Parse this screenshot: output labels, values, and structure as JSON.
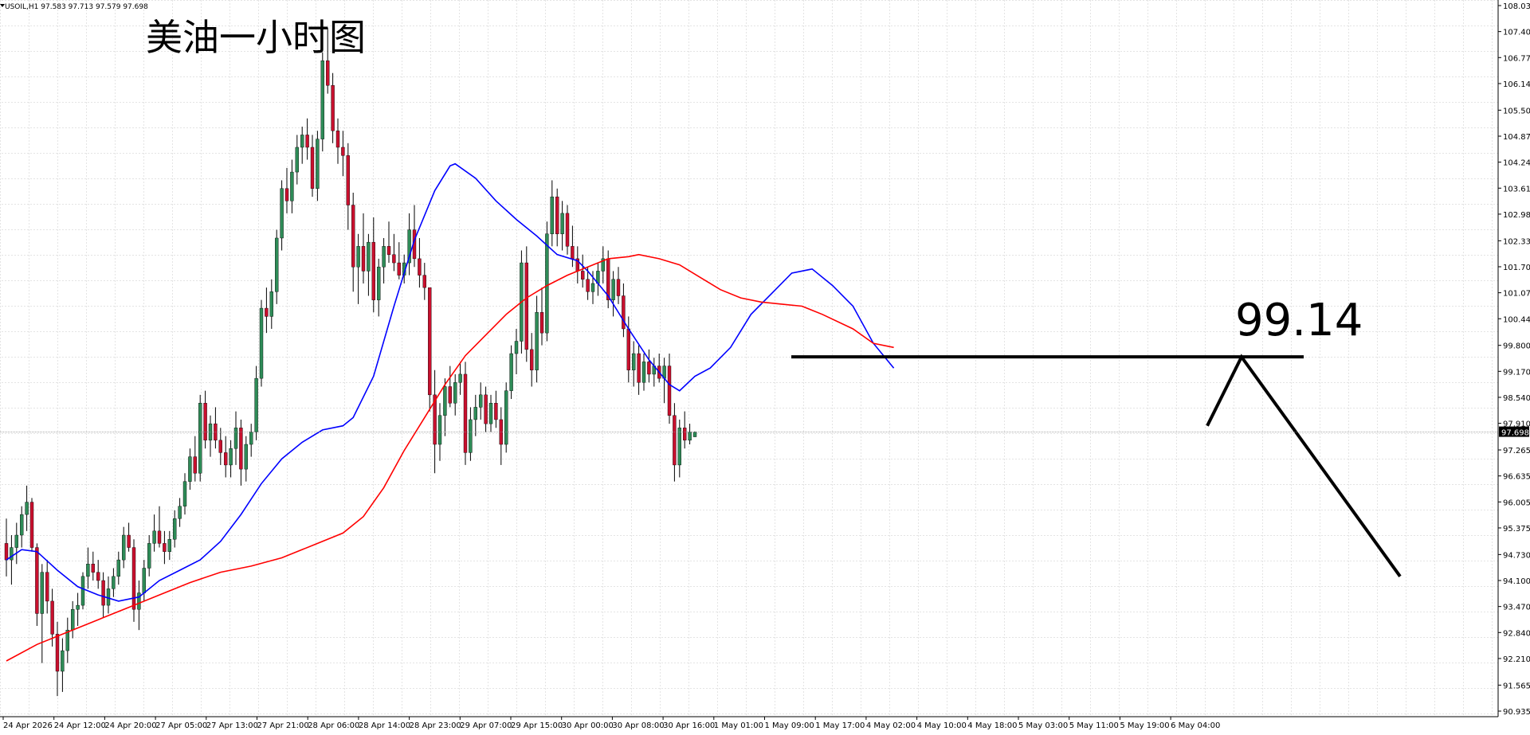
{
  "header": {
    "symbol_line": "USOIL,H1  97.583 97.713 97.579 97.698"
  },
  "annotations": {
    "title": "美油一小时图",
    "level_value": "99.14"
  },
  "colors": {
    "background": "#ffffff",
    "grid": "#c8c8c8",
    "bull_candle": "#2e8b57",
    "bear_candle": "#c8102e",
    "wick": "#000000",
    "ma_fast": "#0000ff",
    "ma_slow": "#ff0000",
    "drawing": "#000000",
    "price_tag": "#000000"
  },
  "chart_data": {
    "type": "candlestick",
    "title": "美油一小时图",
    "symbol": "USOIL",
    "timeframe": "H1",
    "last_bar": {
      "open": 97.583,
      "high": 97.713,
      "low": 97.579,
      "close": 97.698
    },
    "current_price": "97.698",
    "ylim": [
      90.935,
      108.035
    ],
    "y_ticks": [
      "108.035",
      "107.405",
      "106.775",
      "106.145",
      "105.500",
      "104.870",
      "104.240",
      "103.610",
      "102.980",
      "102.335",
      "101.705",
      "101.075",
      "100.445",
      "99.800",
      "99.170",
      "98.540",
      "97.910",
      "97.265",
      "96.635",
      "96.005",
      "95.375",
      "94.730",
      "94.100",
      "93.470",
      "92.840",
      "92.210",
      "91.565",
      "90.935"
    ],
    "x_ticks": [
      "24 Apr 2026",
      "24 Apr 12:00",
      "24 Apr 20:00",
      "27 Apr 05:00",
      "27 Apr 13:00",
      "27 Apr 21:00",
      "28 Apr 06:00",
      "28 Apr 14:00",
      "28 Apr 23:00",
      "29 Apr 07:00",
      "29 Apr 15:00",
      "30 Apr 00:00",
      "30 Apr 08:00",
      "30 Apr 16:00",
      "1 May 01:00",
      "1 May 09:00",
      "1 May 17:00",
      "4 May 02:00",
      "4 May 10:00",
      "4 May 18:00",
      "5 May 03:00",
      "5 May 11:00",
      "5 May 19:00",
      "6 May 04:00"
    ],
    "bars": [
      [
        95.0,
        95.6,
        94.2,
        94.6
      ],
      [
        94.6,
        95.2,
        94.0,
        94.9
      ],
      [
        94.9,
        95.5,
        94.5,
        95.2
      ],
      [
        95.2,
        95.9,
        94.9,
        95.7
      ],
      [
        95.7,
        96.4,
        95.3,
        96.0
      ],
      [
        96.0,
        96.1,
        94.8,
        94.9
      ],
      [
        94.9,
        95.0,
        93.0,
        93.3
      ],
      [
        93.3,
        94.5,
        92.1,
        94.3
      ],
      [
        94.3,
        94.6,
        93.3,
        93.6
      ],
      [
        93.6,
        93.9,
        92.5,
        92.8
      ],
      [
        92.8,
        93.1,
        91.3,
        91.9
      ],
      [
        91.9,
        92.7,
        91.4,
        92.4
      ],
      [
        92.4,
        93.2,
        92.1,
        92.9
      ],
      [
        92.9,
        93.6,
        92.7,
        93.4
      ],
      [
        93.4,
        93.8,
        93.0,
        93.5
      ],
      [
        93.5,
        94.3,
        93.4,
        94.2
      ],
      [
        94.2,
        94.9,
        93.9,
        94.5
      ],
      [
        94.5,
        94.8,
        94.1,
        94.3
      ],
      [
        94.3,
        94.6,
        93.9,
        94.1
      ],
      [
        94.1,
        94.3,
        93.2,
        93.5
      ],
      [
        93.5,
        94.2,
        93.3,
        93.9
      ],
      [
        93.9,
        94.4,
        93.7,
        94.2
      ],
      [
        94.2,
        94.8,
        94.0,
        94.6
      ],
      [
        94.6,
        95.4,
        94.4,
        95.2
      ],
      [
        95.2,
        95.5,
        94.8,
        94.9
      ],
      [
        94.9,
        95.1,
        93.1,
        93.4
      ],
      [
        93.4,
        94.1,
        92.9,
        93.8
      ],
      [
        93.8,
        94.6,
        93.6,
        94.4
      ],
      [
        94.4,
        95.2,
        94.2,
        95.0
      ],
      [
        95.0,
        95.7,
        94.8,
        95.3
      ],
      [
        95.3,
        95.9,
        94.9,
        95.0
      ],
      [
        95.0,
        95.3,
        94.5,
        94.8
      ],
      [
        94.8,
        95.3,
        94.6,
        95.1
      ],
      [
        95.1,
        95.8,
        94.9,
        95.6
      ],
      [
        95.6,
        96.1,
        95.4,
        95.9
      ],
      [
        95.9,
        96.7,
        95.7,
        96.5
      ],
      [
        96.5,
        97.3,
        96.3,
        97.1
      ],
      [
        97.1,
        97.6,
        96.5,
        96.7
      ],
      [
        96.7,
        98.6,
        96.5,
        98.4
      ],
      [
        98.4,
        98.7,
        97.3,
        97.5
      ],
      [
        97.5,
        98.1,
        97.1,
        97.9
      ],
      [
        97.9,
        98.3,
        97.3,
        97.5
      ],
      [
        97.5,
        97.8,
        96.9,
        97.2
      ],
      [
        97.2,
        97.6,
        96.6,
        96.9
      ],
      [
        96.9,
        97.5,
        96.6,
        97.3
      ],
      [
        97.3,
        98.2,
        96.9,
        97.8
      ],
      [
        97.8,
        98.0,
        96.4,
        96.8
      ],
      [
        96.8,
        97.6,
        96.5,
        97.4
      ],
      [
        97.4,
        97.9,
        97.1,
        97.7
      ],
      [
        97.7,
        99.3,
        97.5,
        99.0
      ],
      [
        99.0,
        100.9,
        98.8,
        100.7
      ],
      [
        100.7,
        101.2,
        100.1,
        100.5
      ],
      [
        100.5,
        101.4,
        100.2,
        101.1
      ],
      [
        101.1,
        102.6,
        100.8,
        102.4
      ],
      [
        102.4,
        103.8,
        102.1,
        103.6
      ],
      [
        103.6,
        104.1,
        103.0,
        103.3
      ],
      [
        103.3,
        104.3,
        103.0,
        104.0
      ],
      [
        104.0,
        104.9,
        103.7,
        104.6
      ],
      [
        104.6,
        105.1,
        104.2,
        104.9
      ],
      [
        104.9,
        105.3,
        104.3,
        104.6
      ],
      [
        104.6,
        104.9,
        103.4,
        103.6
      ],
      [
        103.6,
        105.0,
        103.3,
        104.8
      ],
      [
        104.8,
        106.9,
        104.5,
        106.7
      ],
      [
        106.7,
        107.5,
        105.9,
        106.1
      ],
      [
        106.1,
        106.4,
        104.7,
        105.0
      ],
      [
        105.0,
        105.3,
        104.2,
        104.6
      ],
      [
        104.6,
        105.0,
        103.9,
        104.4
      ],
      [
        104.4,
        104.7,
        102.6,
        103.2
      ],
      [
        103.2,
        103.5,
        101.1,
        101.7
      ],
      [
        101.7,
        102.5,
        100.8,
        102.2
      ],
      [
        102.2,
        103.0,
        101.3,
        101.6
      ],
      [
        101.6,
        102.5,
        101.0,
        102.3
      ],
      [
        102.3,
        102.9,
        100.6,
        100.9
      ],
      [
        100.9,
        101.9,
        100.5,
        101.7
      ],
      [
        101.7,
        102.4,
        101.3,
        102.2
      ],
      [
        102.2,
        102.8,
        101.8,
        102.0
      ],
      [
        102.0,
        102.5,
        101.6,
        101.8
      ],
      [
        101.8,
        102.3,
        101.4,
        101.5
      ],
      [
        101.5,
        102.0,
        101.3,
        101.8
      ],
      [
        101.8,
        103.0,
        101.5,
        102.6
      ],
      [
        102.6,
        103.2,
        101.7,
        101.9
      ],
      [
        101.9,
        102.4,
        101.2,
        101.5
      ],
      [
        101.5,
        101.8,
        100.9,
        101.2
      ],
      [
        101.2,
        100.1,
        98.2,
        98.6
      ],
      [
        98.6,
        99.2,
        96.7,
        97.4
      ],
      [
        97.4,
        98.4,
        97.0,
        98.1
      ],
      [
        98.1,
        99.0,
        97.6,
        98.8
      ],
      [
        98.8,
        99.3,
        98.3,
        98.4
      ],
      [
        98.4,
        99.1,
        98.1,
        98.9
      ],
      [
        98.9,
        99.4,
        98.6,
        99.1
      ],
      [
        99.1,
        99.4,
        96.9,
        97.2
      ],
      [
        97.2,
        98.3,
        97.0,
        98.0
      ],
      [
        98.0,
        98.6,
        97.6,
        98.3
      ],
      [
        98.3,
        98.9,
        98.0,
        98.6
      ],
      [
        98.6,
        98.8,
        97.7,
        97.9
      ],
      [
        97.9,
        98.6,
        97.7,
        98.4
      ],
      [
        98.4,
        98.7,
        97.8,
        98.0
      ],
      [
        98.0,
        98.3,
        96.9,
        97.4
      ],
      [
        97.4,
        98.9,
        97.2,
        98.7
      ],
      [
        98.7,
        99.8,
        98.5,
        99.6
      ],
      [
        99.6,
        100.2,
        99.1,
        99.9
      ],
      [
        99.9,
        102.1,
        99.6,
        101.8
      ],
      [
        101.8,
        102.2,
        99.4,
        99.7
      ],
      [
        99.7,
        100.1,
        98.8,
        99.2
      ],
      [
        99.2,
        101.0,
        98.9,
        100.6
      ],
      [
        100.6,
        101.2,
        99.8,
        100.1
      ],
      [
        100.1,
        102.8,
        99.9,
        102.5
      ],
      [
        102.5,
        103.8,
        102.2,
        103.4
      ],
      [
        103.4,
        103.6,
        102.2,
        102.5
      ],
      [
        102.5,
        103.3,
        102.1,
        103.0
      ],
      [
        103.0,
        103.2,
        102.0,
        102.2
      ],
      [
        102.2,
        102.7,
        101.7,
        101.9
      ],
      [
        101.9,
        102.2,
        101.3,
        101.6
      ],
      [
        101.6,
        102.0,
        101.2,
        101.4
      ],
      [
        101.4,
        101.7,
        100.9,
        101.1
      ],
      [
        101.1,
        101.6,
        100.8,
        101.3
      ],
      [
        101.3,
        101.8,
        101.0,
        101.6
      ],
      [
        101.6,
        102.2,
        101.3,
        101.9
      ],
      [
        101.9,
        102.1,
        100.7,
        100.9
      ],
      [
        100.9,
        101.6,
        100.5,
        101.4
      ],
      [
        101.4,
        101.7,
        100.8,
        101.0
      ],
      [
        101.0,
        101.3,
        100.0,
        100.2
      ],
      [
        100.2,
        100.5,
        98.9,
        99.2
      ],
      [
        99.2,
        99.9,
        98.8,
        99.6
      ],
      [
        99.6,
        99.8,
        98.6,
        98.9
      ],
      [
        98.9,
        99.6,
        98.7,
        99.4
      ],
      [
        99.4,
        99.7,
        98.9,
        99.1
      ],
      [
        99.1,
        99.5,
        98.8,
        99.3
      ],
      [
        99.3,
        99.6,
        98.9,
        99.0
      ],
      [
        99.0,
        99.5,
        98.4,
        99.3
      ],
      [
        99.3,
        99.6,
        97.9,
        98.1
      ],
      [
        98.1,
        98.4,
        96.5,
        96.9
      ],
      [
        96.9,
        98.0,
        96.6,
        97.8
      ],
      [
        97.8,
        98.2,
        97.3,
        97.5
      ],
      [
        97.5,
        97.9,
        97.4,
        97.7
      ],
      [
        97.583,
        97.713,
        97.579,
        97.698
      ]
    ],
    "series": [
      {
        "name": "",
        "color": "#0000ff",
        "values": [
          [
            0,
            94.6
          ],
          [
            3,
            94.85
          ],
          [
            6,
            94.8
          ],
          [
            10,
            94.35
          ],
          [
            14,
            93.95
          ],
          [
            18,
            93.75
          ],
          [
            22,
            93.6
          ],
          [
            26,
            93.7
          ],
          [
            30,
            94.1
          ],
          [
            34,
            94.35
          ],
          [
            38,
            94.6
          ],
          [
            42,
            95.05
          ],
          [
            46,
            95.7
          ],
          [
            50,
            96.45
          ],
          [
            54,
            97.05
          ],
          [
            58,
            97.45
          ],
          [
            62,
            97.75
          ],
          [
            66,
            97.85
          ],
          [
            68,
            98.05
          ],
          [
            72,
            99.05
          ],
          [
            76,
            100.75
          ],
          [
            80,
            102.35
          ],
          [
            84,
            103.55
          ],
          [
            87,
            104.15
          ],
          [
            88,
            104.2
          ],
          [
            92,
            103.85
          ],
          [
            96,
            103.3
          ],
          [
            100,
            102.85
          ],
          [
            104,
            102.45
          ],
          [
            108,
            102.0
          ],
          [
            112,
            101.85
          ],
          [
            114,
            101.6
          ],
          [
            118,
            101.0
          ],
          [
            122,
            100.2
          ],
          [
            126,
            99.45
          ],
          [
            130,
            98.85
          ],
          [
            132,
            98.7
          ],
          [
            135,
            99.05
          ],
          [
            138,
            99.25
          ],
          [
            142,
            99.75
          ],
          [
            146,
            100.55
          ],
          [
            150,
            101.05
          ],
          [
            154,
            101.55
          ],
          [
            158,
            101.65
          ],
          [
            162,
            101.25
          ],
          [
            166,
            100.75
          ],
          [
            170,
            99.85
          ],
          [
            174,
            99.25
          ]
        ]
      },
      {
        "name": "",
        "color": "#ff0000",
        "values": [
          [
            0,
            92.15
          ],
          [
            6,
            92.55
          ],
          [
            12,
            92.85
          ],
          [
            18,
            93.15
          ],
          [
            24,
            93.45
          ],
          [
            30,
            93.75
          ],
          [
            36,
            94.05
          ],
          [
            42,
            94.3
          ],
          [
            48,
            94.45
          ],
          [
            54,
            94.65
          ],
          [
            60,
            94.95
          ],
          [
            66,
            95.25
          ],
          [
            70,
            95.65
          ],
          [
            74,
            96.35
          ],
          [
            78,
            97.25
          ],
          [
            82,
            98.05
          ],
          [
            86,
            98.85
          ],
          [
            90,
            99.55
          ],
          [
            94,
            100.05
          ],
          [
            98,
            100.55
          ],
          [
            102,
            100.95
          ],
          [
            106,
            101.25
          ],
          [
            110,
            101.5
          ],
          [
            114,
            101.7
          ],
          [
            118,
            101.9
          ],
          [
            122,
            101.95
          ],
          [
            124,
            102.0
          ],
          [
            128,
            101.9
          ],
          [
            132,
            101.75
          ],
          [
            136,
            101.45
          ],
          [
            140,
            101.15
          ],
          [
            144,
            100.95
          ],
          [
            148,
            100.85
          ],
          [
            152,
            100.8
          ],
          [
            156,
            100.75
          ],
          [
            160,
            100.55
          ],
          [
            166,
            100.2
          ],
          [
            170,
            99.85
          ],
          [
            174,
            99.75
          ]
        ]
      }
    ],
    "drawings": {
      "horizontal_line": 99.52,
      "projection_path_prices": [
        97.85,
        99.52,
        94.2
      ]
    },
    "grid": true
  }
}
